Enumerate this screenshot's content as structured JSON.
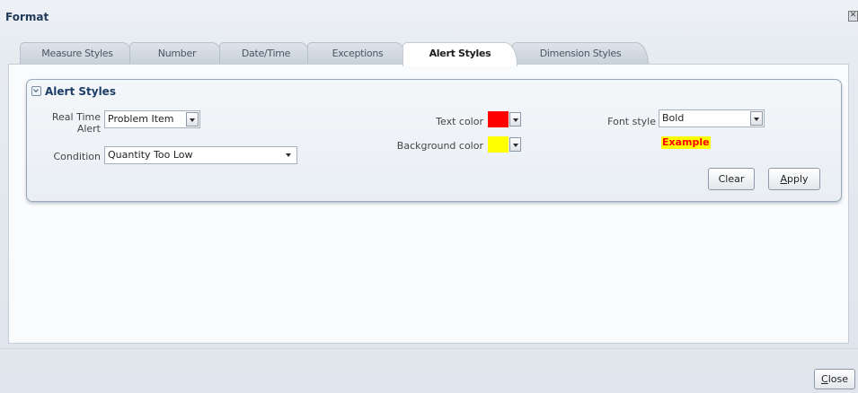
{
  "dialog": {
    "title": "Format",
    "close_glyph": "✕"
  },
  "tabs": [
    {
      "label": "Measure Styles",
      "active": false
    },
    {
      "label": "Number",
      "active": false
    },
    {
      "label": "Date/Time",
      "active": false
    },
    {
      "label": "Exceptions",
      "active": false
    },
    {
      "label": "Alert Styles",
      "active": true
    },
    {
      "label": "Dimension Styles",
      "active": false
    }
  ],
  "alert_styles": {
    "section_title": "Alert Styles",
    "real_time_alert": {
      "label_line1": "Real Time",
      "label_line2": "Alert",
      "value": "Problem Item"
    },
    "condition": {
      "label": "Condition",
      "value": "Quantity Too Low"
    },
    "text_color": {
      "label": "Text color",
      "color": "#ff0000"
    },
    "background_color": {
      "label": "Background color",
      "color": "#ffff00"
    },
    "font_style": {
      "label": "Font style",
      "value": "Bold"
    },
    "example": {
      "text": "Example",
      "text_color": "#ff0000",
      "background_color": "#ffff00"
    },
    "buttons": {
      "clear": "Clear",
      "apply_first": "A",
      "apply_rest": "pply"
    }
  },
  "footer": {
    "close_first": "C",
    "close_rest": "lose"
  },
  "icons": {
    "section_toggle": "chevron-down-icon",
    "dropdown": "triangle-down-icon"
  }
}
